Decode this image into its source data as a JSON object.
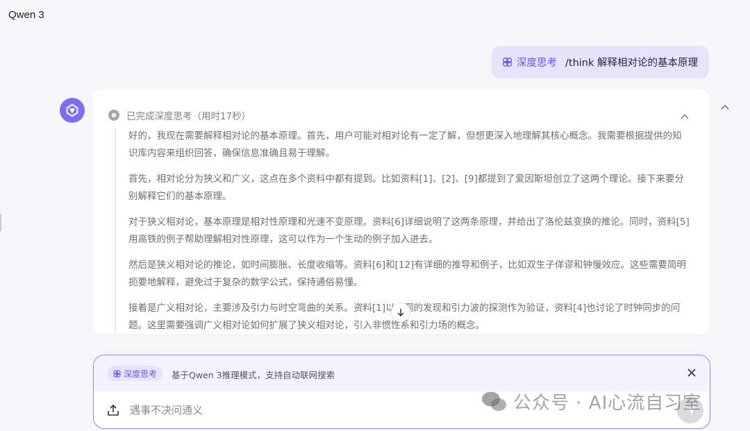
{
  "app": {
    "title": "Qwen 3"
  },
  "user_message": {
    "mode_tag": "深度思考",
    "text": "/think 解释相对论的基本原理"
  },
  "thinking": {
    "status": "已完成深度思考（用时17秒）",
    "paragraphs": [
      "好的，我现在需要解释相对论的基本原理。首先，用户可能对相对论有一定了解，但想更深入地理解其核心概念。我需要根据提供的知识库内容来组织回答，确保信息准确且易于理解。",
      "首先，相对论分为狭义和广义，这点在多个资料中都有提到。比如资料[1]、[2]、[9]都提到了爱因斯坦创立了这两个理论。接下来要分别解释它们的基本原理。",
      "对于狭义相对论，基本原理是相对性原理和光速不变原理。资料[6]详细说明了这两条原理，并给出了洛伦兹变换的推论。同时，资料[5]用高铁的例子帮助理解相对性原理，这可以作为一个生动的例子加入进去。",
      "然后是狭义相对论的推论，如时间膨胀、长度收缩等。资料[6]和[12]有详细的推导和例子，比如双生子佯谬和钟慢效应。这些需要简明扼要地解释，避免过于复杂的数学公式，保持通俗易懂。",
      "接着是广义相对论，主要涉及引力与时空弯曲的关系。资料[1]以黑洞的发现和引力波的探测作为验证，资料[4]也讨论了时钟同步的问题。这里需要强调广义相对论如何扩展了狭义相对论，引入非惯性系和引力场的概念。"
    ]
  },
  "composer": {
    "mode_chip": "深度思考",
    "mode_description": "基于Qwen 3推理模式，支持自动联网搜索",
    "placeholder": "遇事不决问通义"
  },
  "watermark": {
    "text": "公众号 · AI心流自习室"
  },
  "colors": {
    "accent": "#615ced",
    "bubble": "#e6e3fa",
    "avatar": "#7b6ff0"
  }
}
